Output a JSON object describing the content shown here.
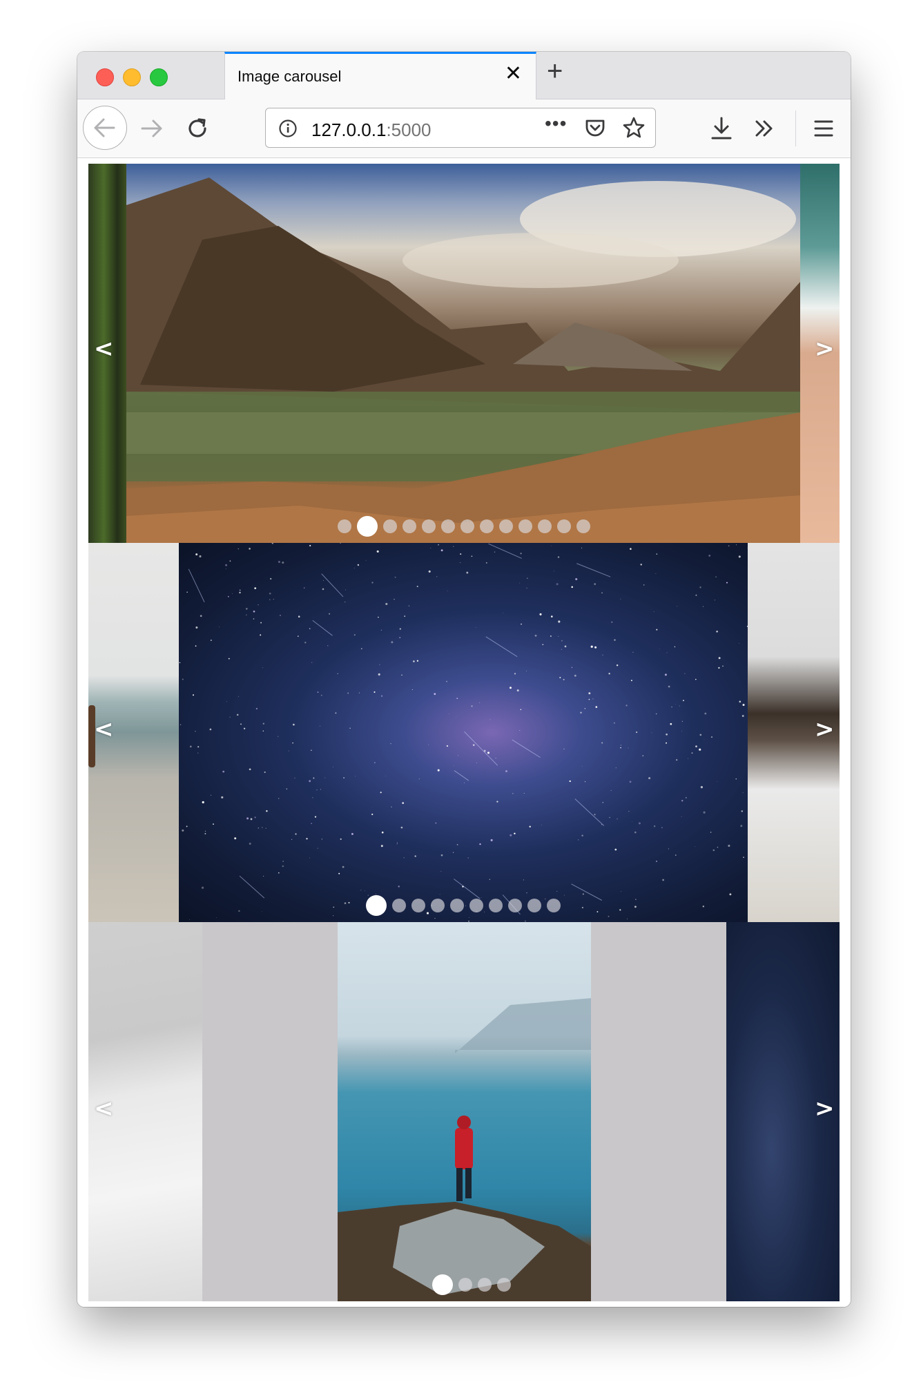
{
  "window": {
    "tab_title": "Image carousel"
  },
  "url": {
    "host": "127.0.0.1",
    "port": ":5000",
    "more_label": "•••"
  },
  "carousels": [
    {
      "name": "mountain-lake-carousel",
      "dot_count": 13,
      "active_dot": 2,
      "prev_label": "<",
      "next_label": ">"
    },
    {
      "name": "starry-sky-carousel",
      "dot_count": 10,
      "active_dot": 1,
      "prev_label": "<",
      "next_label": ">"
    },
    {
      "name": "hiker-carousel",
      "dot_count": 4,
      "active_dot": 1,
      "prev_label": "<",
      "next_label": ">"
    }
  ],
  "colors": {
    "accent": "#0a84ff",
    "letterbox": "#c9c7ca"
  }
}
